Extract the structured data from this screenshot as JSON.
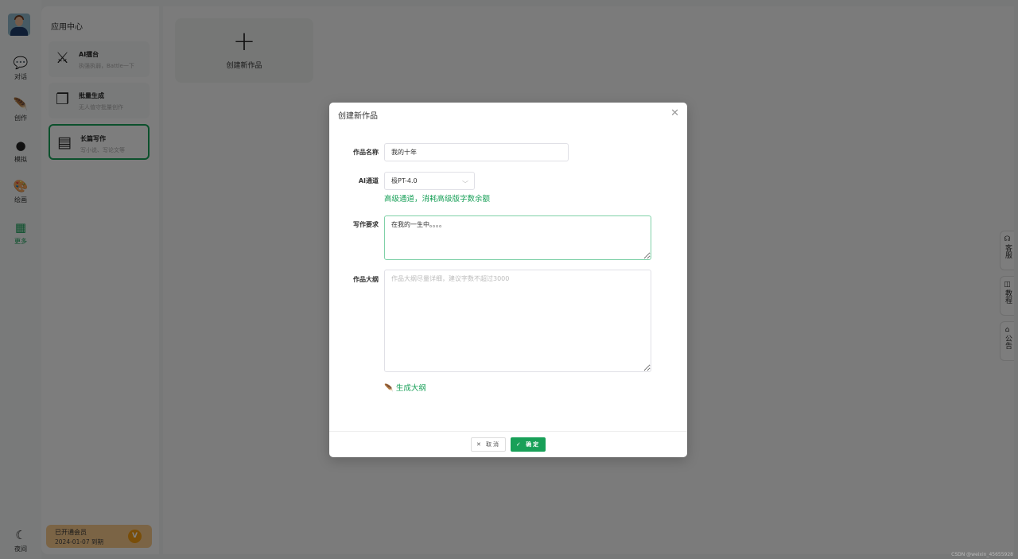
{
  "rail": {
    "items": [
      {
        "label": "对话",
        "icon": "chat-icon"
      },
      {
        "label": "创作",
        "icon": "feather-icon"
      },
      {
        "label": "模拟",
        "icon": "head-icon"
      },
      {
        "label": "绘画",
        "icon": "palette-icon"
      },
      {
        "label": "更多",
        "icon": "grid-icon",
        "active": true
      }
    ],
    "night": {
      "label": "夜间",
      "icon": "moon-icon"
    }
  },
  "panel": {
    "title": "应用中心",
    "cards": [
      {
        "title": "AI擂台",
        "subtitle": "执强执弱，Battle一下",
        "icon": "crossed-swords-icon"
      },
      {
        "title": "批量生成",
        "subtitle": "无人值守批量创作",
        "icon": "batch-icon"
      },
      {
        "title": "长篇写作",
        "subtitle": "写小说、写论文等",
        "icon": "document-icon",
        "active": true
      }
    ],
    "vip": {
      "title": "已开通会员",
      "expiry": "2024-01-07 到期"
    }
  },
  "main": {
    "new_work_label": "创建新作品"
  },
  "side_tabs": [
    "客服",
    "教程",
    "公告"
  ],
  "dialog": {
    "title": "创建新作品",
    "fields": {
      "name_label": "作品名称",
      "name_value": "我的十年",
      "channel_label": "AI通道",
      "channel_value": "极PT-4.0",
      "channel_hint": "高级通道，消耗高级版字数余额",
      "req_label": "写作要求",
      "req_value": "在我的一生中。。。。",
      "outline_label": "作品大纲",
      "outline_placeholder": "作品大纲尽量详细，建议字数不超过3000"
    },
    "generate_label": "生成大纲",
    "cancel_label": "取消",
    "ok_label": "确定"
  },
  "watermark": "CSDN @weixin_45655928",
  "colors": {
    "accent": "#18a058",
    "vip": "#f7c98b"
  }
}
